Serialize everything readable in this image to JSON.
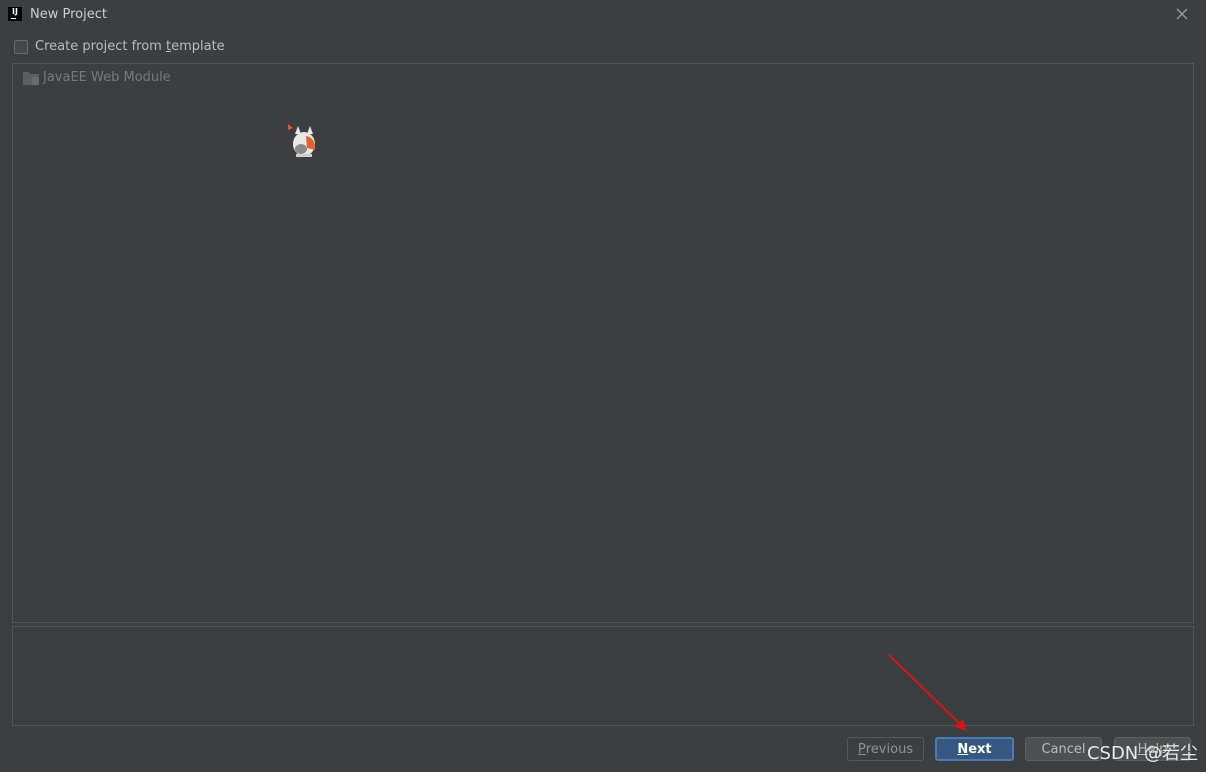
{
  "window": {
    "title": "New Project",
    "app_icon_text": "IJ",
    "close_icon": "close-icon"
  },
  "template_option": {
    "label_before": "Create project from ",
    "label_mnemonic": "t",
    "label_after": "emplate",
    "checked": false
  },
  "template_list": {
    "items": [
      {
        "label": "JavaEE Web Module",
        "icon": "module-folder-icon",
        "enabled": false
      }
    ]
  },
  "description": "",
  "buttons": {
    "previous_mnemonic": "P",
    "previous_rest": "revious",
    "next_mnemonic": "N",
    "next_rest": "ext",
    "cancel": "Cancel",
    "help_mnemonic": "H",
    "help_rest": "elp"
  },
  "annotation": {
    "arrow_color": "#e01010",
    "points_to": "next-button"
  },
  "watermark": "CSDN @若尘",
  "colors": {
    "background": "#3c3f41",
    "primary_button": "#365880",
    "primary_button_border": "#4a7bb5"
  }
}
